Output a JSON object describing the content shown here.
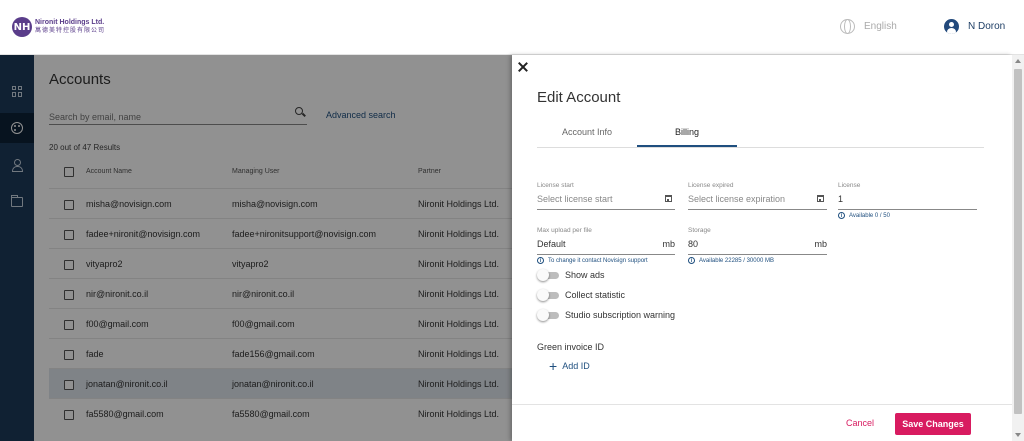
{
  "header": {
    "logo_line1": "Nironit Holdings Ltd.",
    "logo_line2": "萬德美特控股有限公司",
    "logo_icon": "NH",
    "language": "English",
    "user_name": "N Doron"
  },
  "sidebar": {
    "items": [
      {
        "icon": "dashboard-icon"
      },
      {
        "icon": "palette-icon",
        "active": true
      },
      {
        "icon": "person-icon"
      },
      {
        "icon": "folder-icon"
      }
    ]
  },
  "accounts": {
    "title": "Accounts",
    "search_placeholder": "Search by email, name",
    "advanced_search": "Advanced search",
    "results": "20 out of 47 Results",
    "columns": [
      "Account Name",
      "Managing User",
      "Partner"
    ],
    "rows": [
      {
        "name": "misha@novisign.com",
        "user": "misha@novisign.com",
        "partner": "Nironit Holdings Ltd."
      },
      {
        "name": "fadee+nironit@novisign.com",
        "user": "fadee+nironitsupport@novisign.com",
        "partner": "Nironit Holdings Ltd."
      },
      {
        "name": "vityapro2",
        "user": "vityapro2",
        "partner": "Nironit Holdings Ltd."
      },
      {
        "name": "nir@nironit.co.il",
        "user": "nir@nironit.co.il",
        "partner": "Nironit Holdings Ltd."
      },
      {
        "name": "f00@gmail.com",
        "user": "f00@gmail.com",
        "partner": "Nironit Holdings Ltd."
      },
      {
        "name": "fade",
        "user": "fade156@gmail.com",
        "partner": "Nironit Holdings Ltd."
      },
      {
        "name": "jonatan@nironit.co.il",
        "user": "jonatan@nironit.co.il",
        "partner": "Nironit Holdings Ltd."
      },
      {
        "name": "fa5580@gmail.com",
        "user": "fa5580@gmail.com",
        "partner": "Nironit Holdings Ltd."
      }
    ]
  },
  "drawer": {
    "title": "Edit Account",
    "tabs": [
      {
        "label": "Account Info",
        "active": false
      },
      {
        "label": "Billing",
        "active": true
      }
    ],
    "license_start": {
      "label": "License start",
      "placeholder": "Select license start"
    },
    "license_expired": {
      "label": "License expired",
      "placeholder": "Select license expiration"
    },
    "license": {
      "label": "License",
      "value": "1",
      "hint": "Available 0 / 50"
    },
    "max_upload": {
      "label": "Max upload per file",
      "value": "Default",
      "unit": "mb",
      "hint": "To change it contact Novisign support"
    },
    "storage": {
      "label": "Storage",
      "value": "80",
      "unit": "mb",
      "hint": "Available 22285 / 30000 MB"
    },
    "toggles": [
      {
        "label": "Show ads",
        "on": false
      },
      {
        "label": "Collect statistic",
        "on": false
      },
      {
        "label": "Studio subscription warning",
        "on": false
      }
    ],
    "green_invoice_title": "Green invoice ID",
    "add_id": "Add ID",
    "cancel": "Cancel",
    "save": "Save Changes"
  },
  "colors": {
    "accent": "#d81b60",
    "primary": "#1f4f7f",
    "nav": "#1d3a5b"
  }
}
